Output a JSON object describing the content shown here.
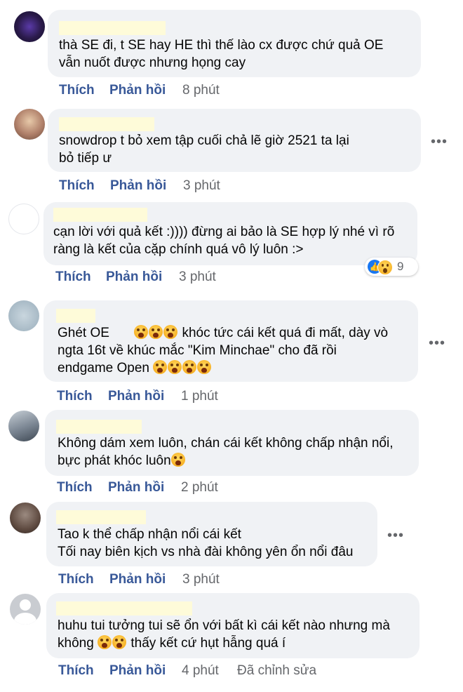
{
  "comments": [
    {
      "text": "thà SE đi, t SE hay HE thì thế lào cx được chứ quả OE\nvẫn nuốt được nhưng họng cay",
      "like": "Thích",
      "reply": "Phản hồi",
      "time": "8 phút"
    },
    {
      "text": "snowdrop t bỏ xem tập cuối chả lẽ giờ 2521 ta lại\nbỏ tiếp ư",
      "like": "Thích",
      "reply": "Phản hồi",
      "time": "3 phút"
    },
    {
      "text": "cạn lời với quả kết :)))) đừng ai bảo là SE hợp lý nhé vì rõ\nràng là kết của cặp chính quá vô lý luôn :>",
      "like": "Thích",
      "reply": "Phản hồi",
      "time": "3 phút",
      "reactions": {
        "types": [
          "like",
          "wow"
        ],
        "count": "9"
      }
    },
    {
      "text_a": "Ghét OE",
      "text_b": "khóc tức cái kết quá đi mất, dày vò",
      "text_c": "ngta 16t về khúc mắc \"Kim Minchae\" cho đã rồi",
      "text_d": "endgame Open",
      "like": "Thích",
      "reply": "Phản hồi",
      "time": "1 phút"
    },
    {
      "text_a": "Không dám xem luôn, chán cái kết không chấp nhận nổi,",
      "text_b": "bực phát khóc luôn",
      "like": "Thích",
      "reply": "Phản hồi",
      "time": "2 phút"
    },
    {
      "text": "Tao k thể chấp nhận nổi cái kết\nTối nay biên kịch vs nhà đài không yên ổn nổi đâu",
      "like": "Thích",
      "reply": "Phản hồi",
      "time": "3 phút"
    },
    {
      "text_a": "huhu tui tưởng tui sẽ ổn với bất kì cái kết nào nhưng mà",
      "text_b": "không",
      "text_c": "thấy kết cứ hụt hẫng quá í",
      "like": "Thích",
      "reply": "Phản hồi",
      "time": "4 phút",
      "edited": "Đã chỉnh sửa"
    }
  ],
  "icons": {
    "more": "more-options-icon",
    "emoji": "loudly-crying-face-emoji",
    "reaction_like": "like-reaction-icon",
    "reaction_wow": "wow-reaction-icon"
  },
  "colors": {
    "bubble": "#f0f2f5",
    "action_link": "#385898",
    "meta": "#65676b",
    "name_redaction": "#fefbd9"
  }
}
